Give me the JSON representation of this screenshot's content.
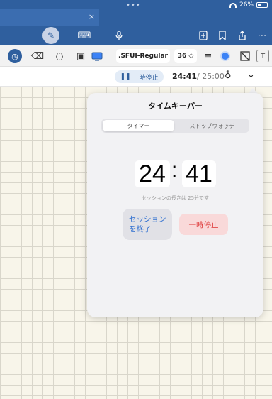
{
  "status_bar": {
    "battery": "26%",
    "dots": "•••"
  },
  "tab": {
    "close_glyph": "×"
  },
  "toolbar": {
    "icons": [
      "pen-icon",
      "keyboard-icon",
      "microphone-icon",
      "add-page-icon",
      "bookmark-icon",
      "share-icon",
      "more-icon"
    ]
  },
  "tools": {
    "font_name": ".SFUI-Regular",
    "font_size": "36 ◇",
    "accent_color": "#3b82f6"
  },
  "timer_bar": {
    "pause_label": "一時停止",
    "elapsed": "24:41",
    "total": "/ 25:00"
  },
  "popover": {
    "title": "タイムキーパー",
    "segments": [
      "タイマー",
      "ストップウォッチ"
    ],
    "selected_segment": "タイマー",
    "minutes": "24",
    "separator": ":",
    "seconds": "41",
    "session_note": "セッションの長さは 25分です",
    "end_session_line1": "セッション",
    "end_session_line2": "を終了",
    "pause_button": "一時停止"
  }
}
